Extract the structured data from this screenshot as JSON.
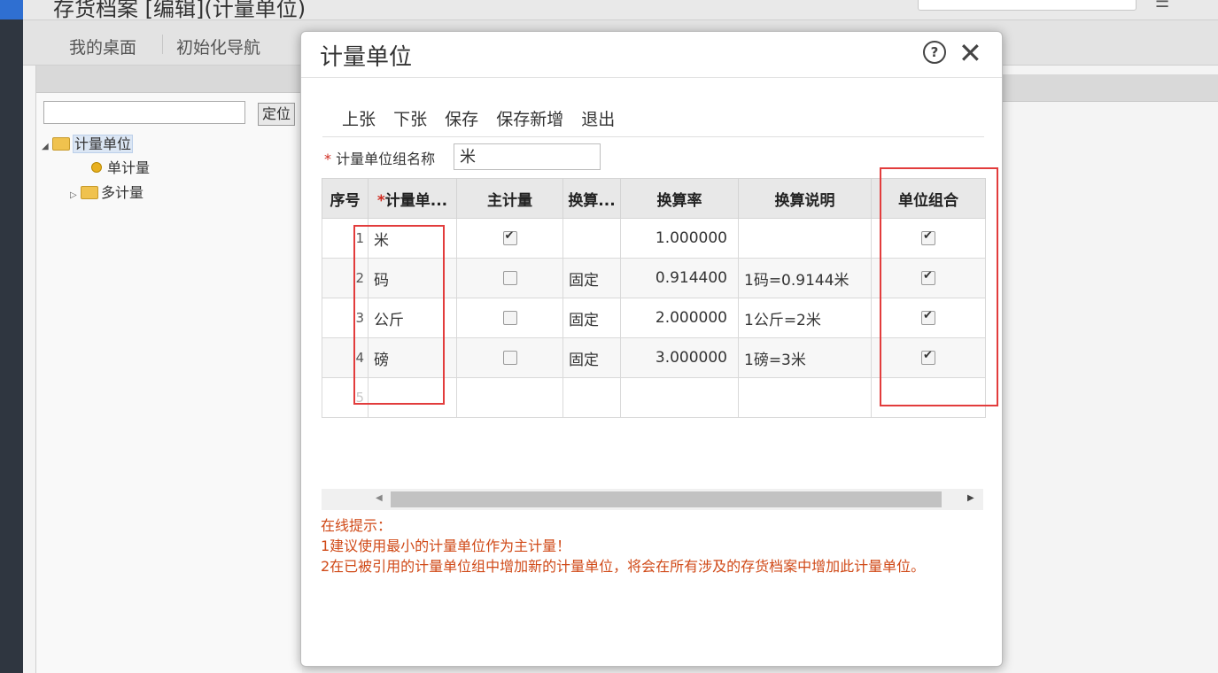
{
  "app": {
    "title_partial": "存货档案  [编辑](计量单位)",
    "navtabs": [
      "我的桌面",
      "初始化导航"
    ]
  },
  "tree": {
    "locate_button": "定位",
    "root": "计量单位",
    "children": [
      "单计量",
      "多计量"
    ]
  },
  "dialog": {
    "title": "计量单位",
    "help_icon": "question-circle-icon",
    "close_icon": "close-icon",
    "toolbar": [
      "上张",
      "下张",
      "保存",
      "保存新增",
      "退出"
    ],
    "group_name_label": "计量单位组名称",
    "group_name_value": "米",
    "required_mark": "*"
  },
  "grid": {
    "headers": [
      "序号",
      "计量单...",
      "主计量",
      "换算...",
      "换算率",
      "换算说明",
      "单位组合"
    ],
    "rows": [
      {
        "no": "1",
        "unit": "米",
        "main": true,
        "conv_type": "",
        "rate": "1.000000",
        "desc": "",
        "combo": true
      },
      {
        "no": "2",
        "unit": "码",
        "main": false,
        "conv_type": "固定",
        "rate": "0.914400",
        "desc": "1码=0.9144米",
        "combo": true
      },
      {
        "no": "3",
        "unit": "公斤",
        "main": false,
        "conv_type": "固定",
        "rate": "2.000000",
        "desc": "1公斤=2米",
        "combo": true
      },
      {
        "no": "4",
        "unit": "磅",
        "main": false,
        "conv_type": "固定",
        "rate": "3.000000",
        "desc": "1磅=3米",
        "combo": true
      },
      {
        "no": "5",
        "unit": "",
        "main": null,
        "conv_type": "",
        "rate": "",
        "desc": "",
        "combo": null
      }
    ]
  },
  "tips": {
    "title": "在线提示：",
    "lines": [
      "1建议使用最小的计量单位作为主计量！",
      "2在已被引用的计量单位组中增加新的计量单位，将会在所有涉及的存货档案中增加此计量单位。"
    ]
  },
  "colors": {
    "tip_text": "#d04a18",
    "highlight_box": "#e23c3c"
  }
}
